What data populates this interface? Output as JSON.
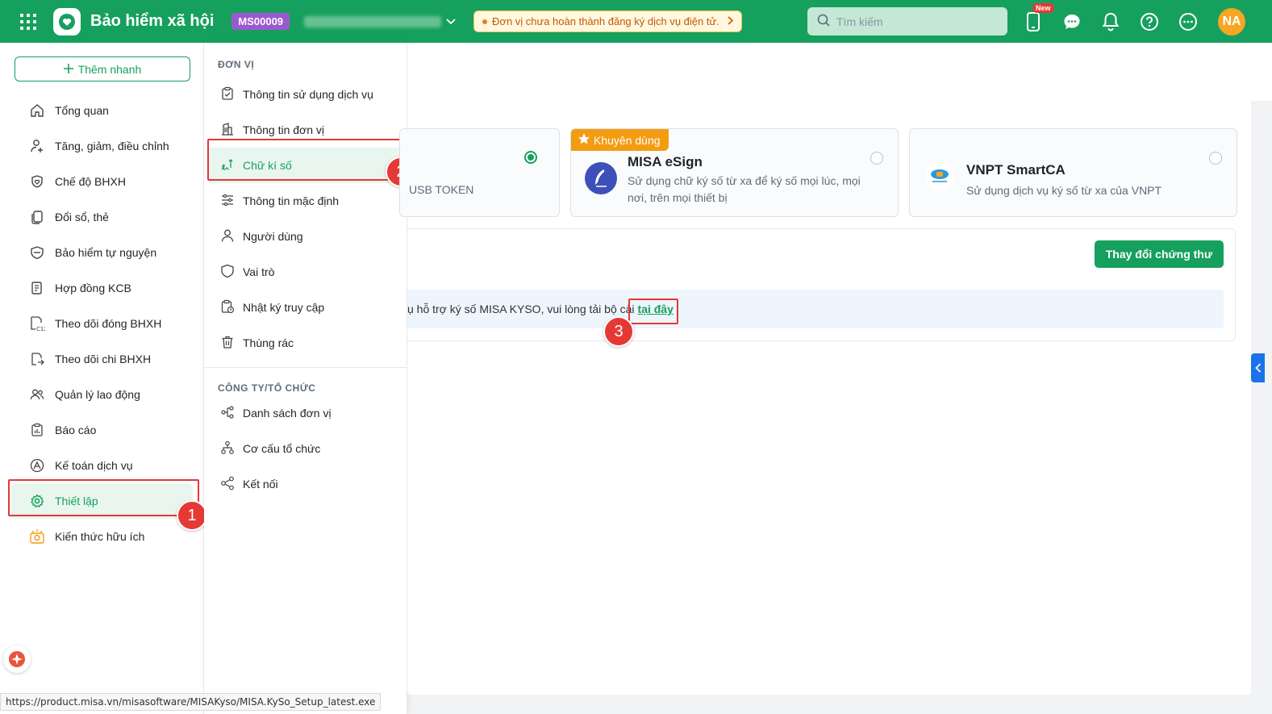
{
  "header": {
    "app_title": "Bảo hiểm xã hội",
    "unit_code": "MS00009",
    "warning": "Đơn vị chưa hoàn thành đăng ký dịch vụ điện tử.",
    "search_placeholder": "Tìm kiếm",
    "new_badge": "New",
    "avatar_initials": "NA"
  },
  "sidebar": {
    "quick_add": "Thêm nhanh",
    "items": [
      {
        "label": "Tổng quan",
        "icon": "home-icon"
      },
      {
        "label": "Tăng, giảm, điều chỉnh",
        "icon": "user-adjust-icon"
      },
      {
        "label": "Chế độ BHXH",
        "icon": "heart-shield-icon"
      },
      {
        "label": "Đổi sổ, thẻ",
        "icon": "card-swap-icon"
      },
      {
        "label": "Bảo hiểm tự nguyện",
        "icon": "shield-icon"
      },
      {
        "label": "Hợp đồng KCB",
        "icon": "contract-icon"
      },
      {
        "label": "Theo dõi đóng BHXH",
        "icon": "c12-report-icon"
      },
      {
        "label": "Theo dõi chi BHXH",
        "icon": "payout-icon"
      },
      {
        "label": "Quản lý lao động",
        "icon": "people-icon"
      },
      {
        "label": "Báo cáo",
        "icon": "report-icon"
      },
      {
        "label": "Kế toán dịch vụ",
        "icon": "accounting-icon"
      },
      {
        "label": "Thiết lập",
        "icon": "gear-icon"
      },
      {
        "label": "Kiến thức hữu ích",
        "icon": "lightbulb-icon"
      }
    ]
  },
  "submenu": {
    "group1_title": "ĐƠN VỊ",
    "group1": [
      {
        "label": "Thông tin sử dụng dịch vụ"
      },
      {
        "label": "Thông tin đơn vị"
      },
      {
        "label": "Chữ kí số"
      },
      {
        "label": "Thông tin mặc định"
      },
      {
        "label": "Người dùng"
      },
      {
        "label": "Vai trò"
      },
      {
        "label": "Nhật ký truy cập"
      },
      {
        "label": "Thùng rác"
      }
    ],
    "group2_title": "CÔNG TY/TỔ CHỨC",
    "group2": [
      {
        "label": "Danh sách đơn vị"
      },
      {
        "label": "Cơ cấu tổ chức"
      },
      {
        "label": "Kết nối"
      }
    ]
  },
  "main": {
    "card1_desc": "USB TOKEN",
    "card2_tag": "Khuyên dùng",
    "card2_title": "MISA eSign",
    "card2_desc": "Sử dụng chữ ký số từ xa để ký số mọi lúc, mọi nơi, trên mọi thiết bị",
    "card3_title": "VNPT SmartCA",
    "card3_desc": "Sử dụng dịch vụ ký số từ xa của VNPT",
    "change_button": "Thay đổi chứng thư",
    "info_text": "ụ hỗ trợ ký số MISA KYSO, vui lòng tải bộ cài",
    "info_link": "tại đây"
  },
  "annotations": {
    "step1": "1",
    "step2": "2",
    "step3": "3"
  },
  "status_url": "https://product.misa.vn/misasoftware/MISAKyso/MISA.KySo_Setup_latest.exe",
  "colors": {
    "brand_green": "#16a05d",
    "highlight_red": "#e53935",
    "badge_purple": "#9b59d0",
    "recommend_orange": "#f39c12"
  }
}
